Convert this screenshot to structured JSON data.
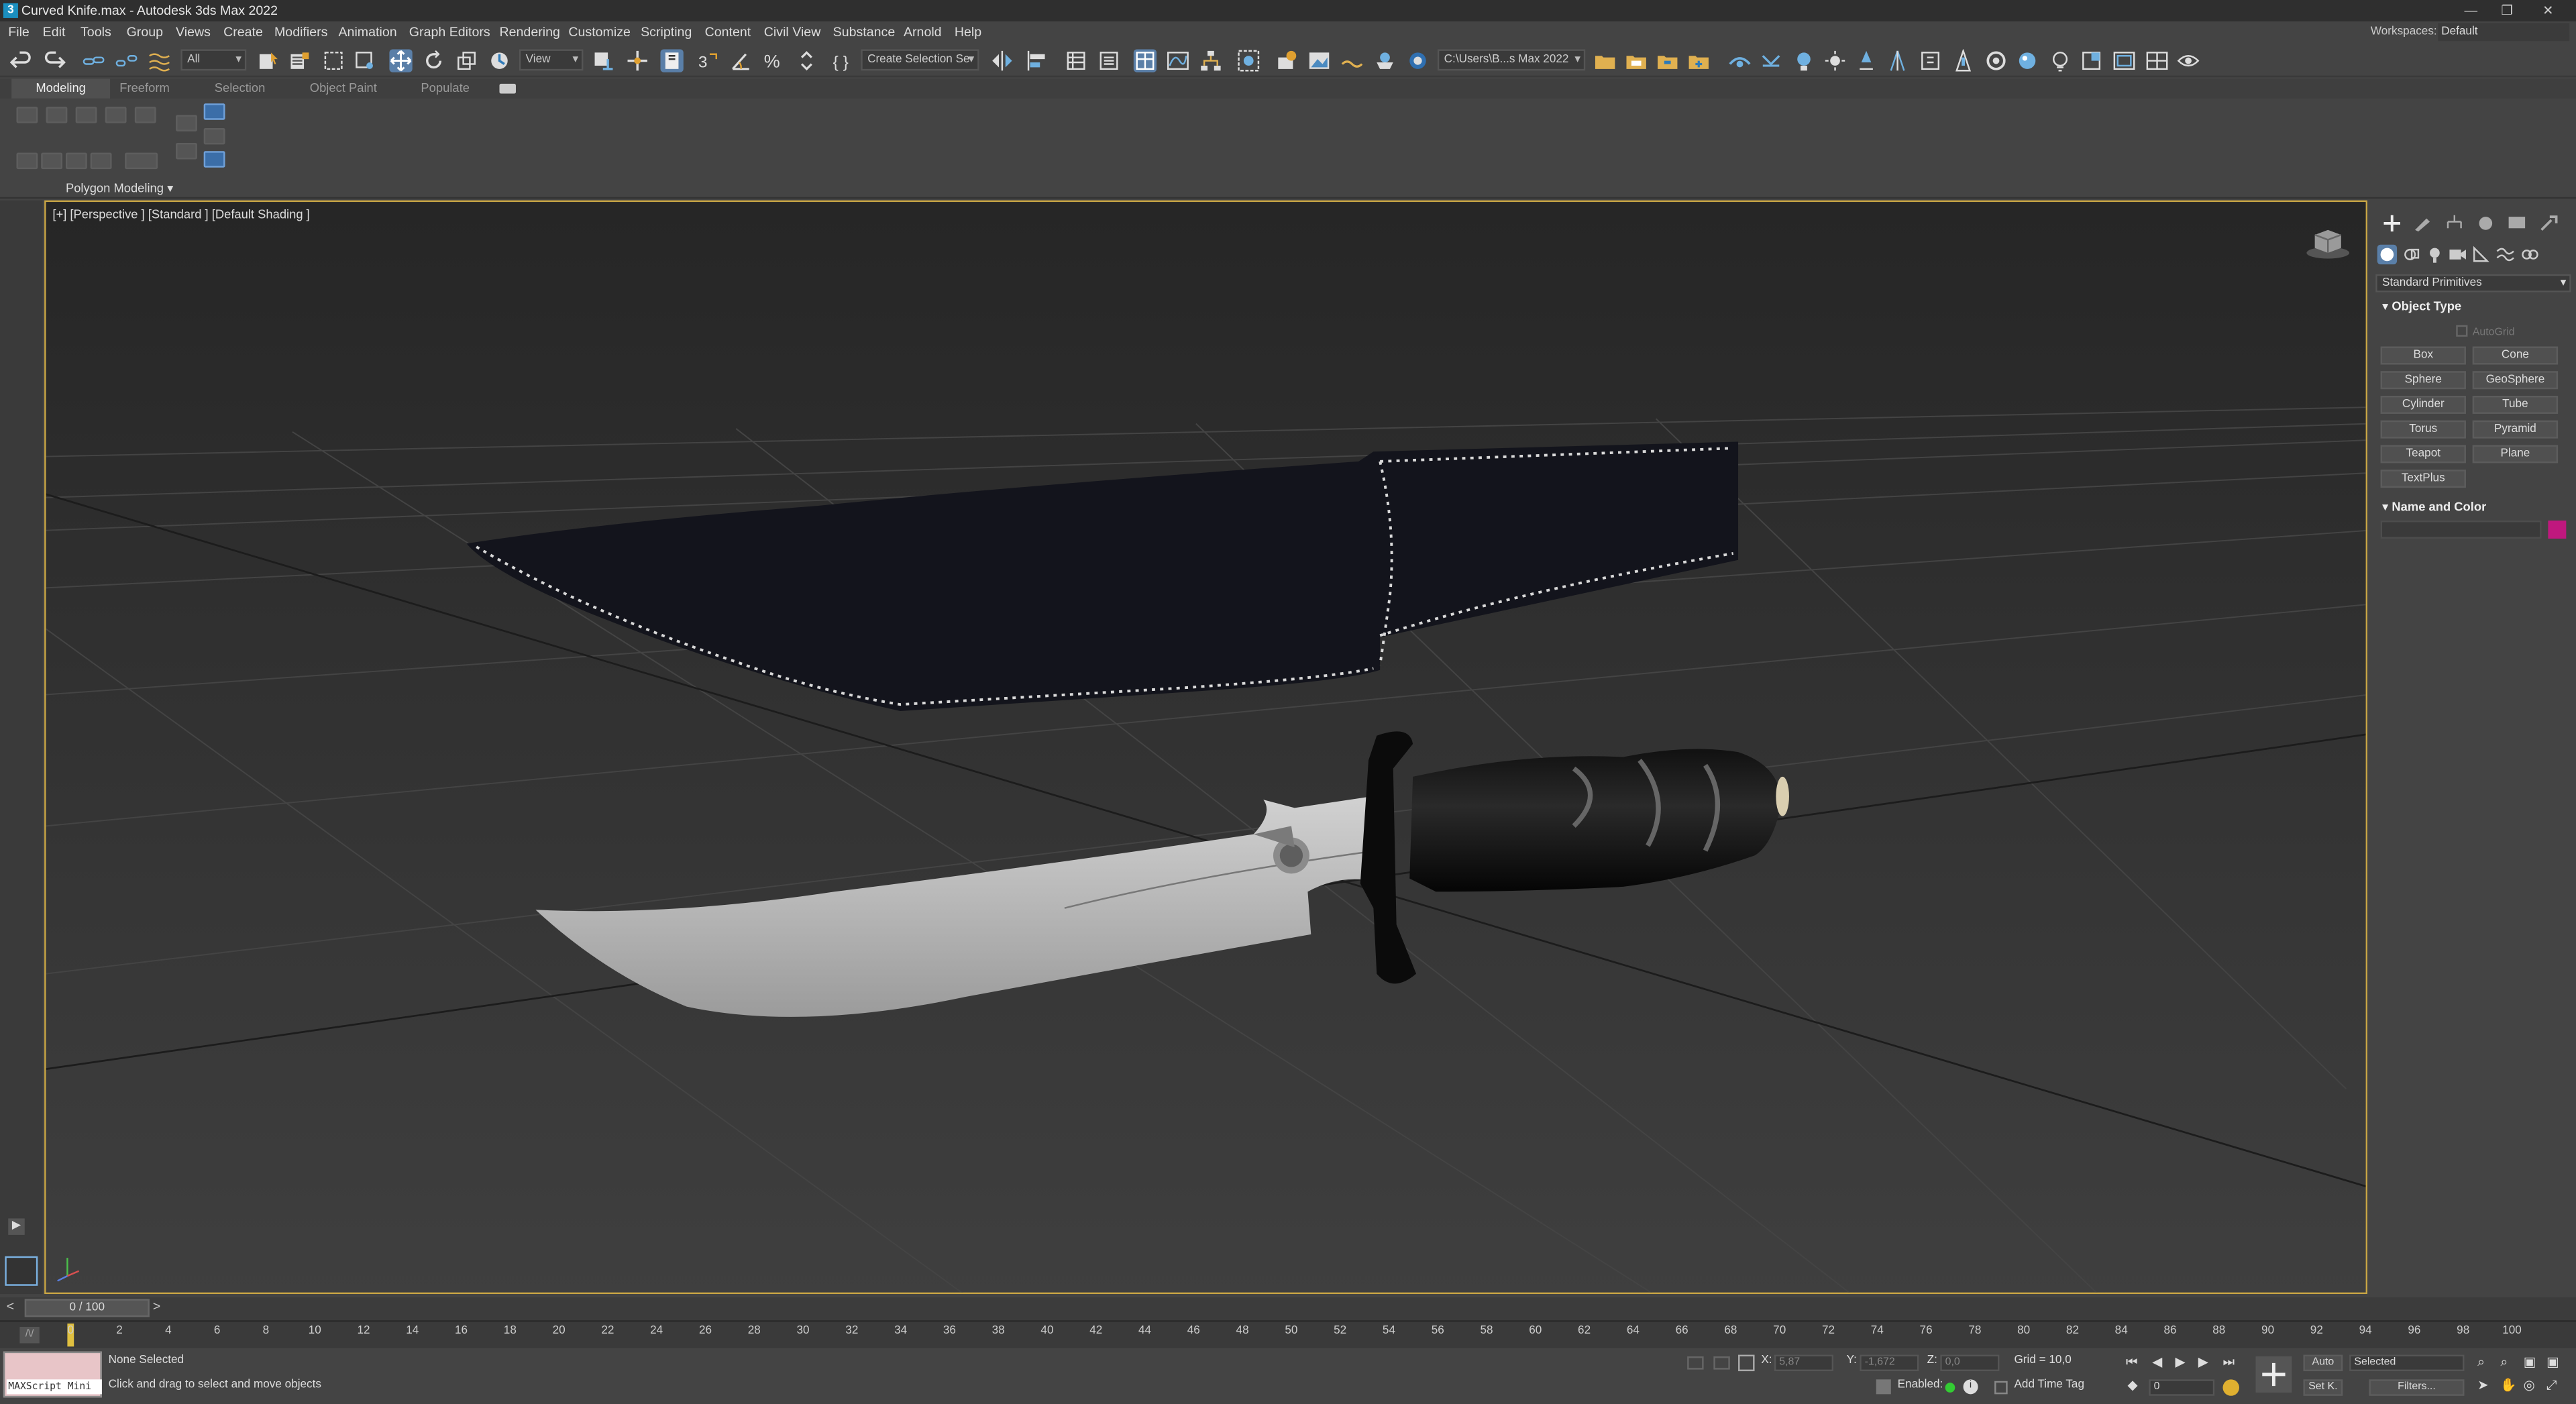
{
  "window": {
    "title": "Curved Knife.max - Autodesk 3ds Max 2022",
    "controls": [
      "—",
      "❐",
      "✕"
    ]
  },
  "menu": {
    "items": [
      "File",
      "Edit",
      "Tools",
      "Group",
      "Views",
      "Create",
      "Modifiers",
      "Animation",
      "Graph Editors",
      "Rendering",
      "Customize",
      "Scripting",
      "Content",
      "Civil View",
      "Substance",
      "Arnold",
      "Help"
    ],
    "workspaces_label": "Workspaces:",
    "workspaces_value": "Default"
  },
  "toolbar": {
    "filter_value": "All",
    "refcoord_value": "View",
    "selection_set_placeholder": "Create Selection Se",
    "project_path": "C:\\Users\\B...s Max 2022"
  },
  "ribbon": {
    "tabs": [
      "Modeling",
      "Freeform",
      "Selection",
      "Object Paint",
      "Populate"
    ],
    "active_tab": "Modeling",
    "panel_label": "Polygon Modeling ▾"
  },
  "viewport": {
    "label": "[+] [Perspective ] [Standard ] [Default Shading ]"
  },
  "command_panel": {
    "dropdown": "Standard Primitives",
    "object_type_title": "Object Type",
    "autogrid_label": "AutoGrid",
    "buttons": [
      "Box",
      "Cone",
      "Sphere",
      "GeoSphere",
      "Cylinder",
      "Tube",
      "Torus",
      "Pyramid",
      "Teapot",
      "Plane",
      "TextPlus"
    ],
    "name_color_title": "Name and Color",
    "object_color": "#c0187e"
  },
  "timeline": {
    "position": "0 / 100",
    "ticks": [
      "0",
      "2",
      "4",
      "6",
      "8",
      "10",
      "12",
      "14",
      "16",
      "18",
      "20",
      "22",
      "24",
      "26",
      "28",
      "30",
      "32",
      "34",
      "36",
      "38",
      "40",
      "42",
      "44",
      "46",
      "48",
      "50",
      "52",
      "54",
      "56",
      "58",
      "60",
      "62",
      "64",
      "66",
      "68",
      "70",
      "72",
      "74",
      "76",
      "78",
      "80",
      "82",
      "84",
      "86",
      "88",
      "90",
      "92",
      "94",
      "96",
      "98",
      "100"
    ]
  },
  "status": {
    "maxscript_label": "MAXScript Mini",
    "selection_status": "None Selected",
    "prompt": "Click and drag to select and move objects",
    "x_label": "X:",
    "x_value": "5,87",
    "y_label": "Y:",
    "y_value": "-1,672",
    "z_label": "Z:",
    "z_value": "0,0",
    "grid": "Grid = 10,0",
    "enabled_label": "Enabled:",
    "add_time_tag": "Add Time Tag",
    "auto_key": "Auto",
    "set_key": "Set K.",
    "key_filter": "Selected",
    "filters": "Filters...",
    "frame_value": "0"
  }
}
